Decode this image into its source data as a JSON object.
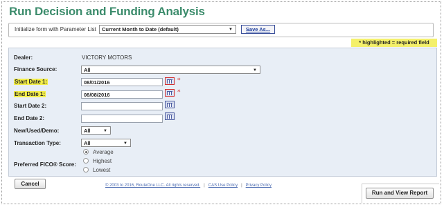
{
  "page": {
    "title": "Run Decision and Funding Analysis"
  },
  "param": {
    "label": "Initialize form with Parameter List",
    "selected": "Current Month to Date (default)",
    "save_as": "Save As..."
  },
  "required_note": "* highlighted = required field",
  "form": {
    "dealer_label": "Dealer:",
    "dealer_value": "VICTORY MOTORS",
    "finance_label": "Finance Source:",
    "finance_value": "All",
    "start1_label": "Start Date 1:",
    "start1_value": "08/01/2016",
    "end1_label": "End Date 1:",
    "end1_value": "08/08/2016",
    "start2_label": "Start Date 2:",
    "start2_value": "",
    "end2_label": "End Date 2:",
    "end2_value": "",
    "nud_label": "New/Used/Demo:",
    "nud_value": "All",
    "tt_label": "Transaction Type:",
    "tt_value": "All",
    "fico_label": "Preferred FICO® Score:",
    "fico_options": [
      "Average",
      "Highest",
      "Lowest"
    ],
    "fico_selected": "Average",
    "required_star": "*"
  },
  "buttons": {
    "cancel": "Cancel",
    "run": "Run and View Report"
  },
  "footer": {
    "copyright": "© 2003 to 2016, RouteOne LLC. All rights reserved.",
    "cas": "CAS Use Policy",
    "privacy": "Privacy Policy",
    "sep": "|"
  },
  "colors": {
    "title": "#3c8c6c",
    "required_highlight": "#f4ef48",
    "panel": "#e8eef6"
  }
}
